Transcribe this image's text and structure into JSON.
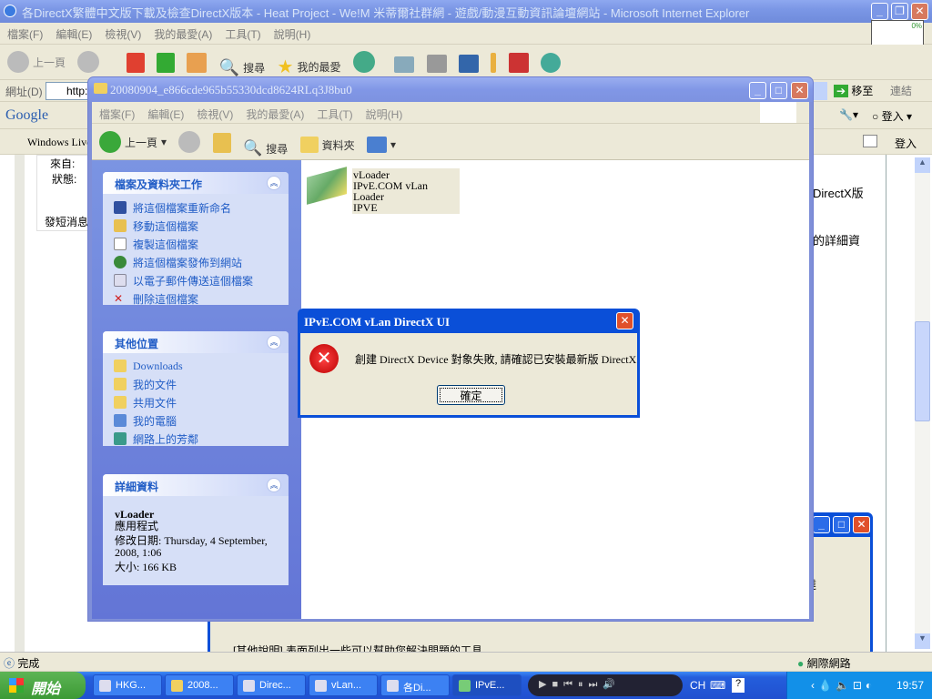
{
  "ie": {
    "title": "各DirectX繁體中文版下載及檢查DirectX版本 - Heat Project - We!M 米蒂爾社群網 - 遊戲/動漫互動資訊論壇網站 - Microsoft Internet Explorer",
    "menu": [
      "檔案(F)",
      "編輯(E)",
      "檢視(V)",
      "我的最愛(A)",
      "工具(T)",
      "說明(H)"
    ],
    "toolbar": {
      "back": "上一頁",
      "search": "搜尋",
      "favorites": "我的最愛"
    },
    "address_label": "網址(D)",
    "address_value": "http://",
    "go": "移至",
    "links": "連結",
    "google": {
      "logo": "Google",
      "signin": "登入"
    },
    "windows_live": {
      "label": "Windows Live",
      "signin": "登入"
    },
    "progress_badge": "0%",
    "page": {
      "source": "來自:",
      "status": "狀態:",
      "sms": "發短消息",
      "right1": "DirectX版",
      "right2": "的詳細資",
      "right3": "以達",
      "bottom": "[其他說明] 表面列出一些可以幫助您解決問題的工具。"
    },
    "statusbar": {
      "left": "完成",
      "zone": "網際網路"
    }
  },
  "folder": {
    "title": "20080904_e866cde965b55330dcd8624RLq3J8bu0",
    "menu": [
      "檔案(F)",
      "編輯(E)",
      "檢視(V)",
      "我的最愛(A)",
      "工具(T)",
      "說明(H)"
    ],
    "toolbar": {
      "back": "上一頁",
      "search": "搜尋",
      "folders": "資料夾"
    },
    "tasks": {
      "title": "檔案及資料夾工作",
      "items": [
        "將這個檔案重新命名",
        "移動這個檔案",
        "複製這個檔案",
        "將這個檔案發佈到網站",
        "以電子郵件傳送這個檔案",
        "刪除這個檔案"
      ]
    },
    "places": {
      "title": "其他位置",
      "items": [
        "Downloads",
        "我的文件",
        "共用文件",
        "我的電腦",
        "網路上的芳鄰"
      ]
    },
    "details": {
      "title": "詳細資料",
      "name": "vLoader",
      "type": "應用程式",
      "modified": "修改日期: Thursday, 4 September, 2008, 1:06",
      "size": "大小: 166 KB"
    },
    "file": {
      "name": "vLoader",
      "desc": "IPvE.COM vLan Loader",
      "company": "IPVE"
    }
  },
  "dialog": {
    "title": "IPvE.COM vLan DirectX UI",
    "message": "創建 DirectX Device 對象失敗, 請確認已安裝最新版 DirectX",
    "ok": "確定"
  },
  "taskbar": {
    "start": "開始",
    "tasks": [
      "HKG...",
      "2008...",
      "Direc...",
      "vLan...",
      "各Di...",
      "IPvE..."
    ],
    "lang": "CH",
    "clock": "19:57"
  }
}
